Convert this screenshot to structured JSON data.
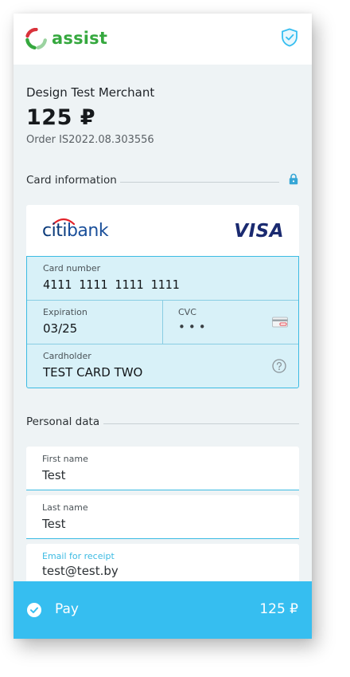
{
  "brand": {
    "name": "assist",
    "color": "#35a83e"
  },
  "merchant": {
    "name": "Design Test Merchant",
    "amount": "125 ₽",
    "order": "Order IS2022.08.303556"
  },
  "card_section": {
    "title": "Card information",
    "bank": {
      "part1": "citi",
      "part2": "bank"
    },
    "network": "VISA",
    "card_number_label": "Card number",
    "card_number_value": "4111 1111 1111 1111",
    "expiration_label": "Expiration",
    "expiration_value": "03/25",
    "cvc_label": "CVC",
    "cvc_value": "•••",
    "cardholder_label": "Cardholder",
    "cardholder_value": "TEST CARD TWO"
  },
  "personal_section": {
    "title": "Personal data",
    "first_name_label": "First name",
    "first_name_value": "Test",
    "last_name_label": "Last name",
    "last_name_value": "Test",
    "email_label": "Email for receipt",
    "email_value": "test@test.by"
  },
  "pay": {
    "label": "Pay",
    "amount": "125 ₽",
    "color": "#36bef0"
  },
  "icons": [
    "assist-logo-icon",
    "shield-check-icon",
    "lock-icon",
    "card-cvc-icon",
    "help-icon",
    "check-circle-icon"
  ]
}
